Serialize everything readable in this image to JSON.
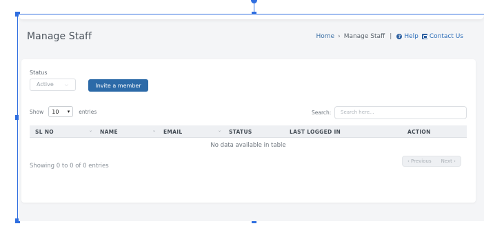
{
  "page": {
    "title": "Manage Staff"
  },
  "breadcrumb": {
    "home": "Home",
    "separator": "›",
    "current": "Manage Staff",
    "divider": "|",
    "help": "Help",
    "contact": "Contact Us"
  },
  "filters": {
    "status_label": "Status",
    "status_value": "Active",
    "invite_button": "Invite a member"
  },
  "table_controls": {
    "show_label": "Show",
    "page_length": "10",
    "entries_label": "entries",
    "search_label": "Search:",
    "search_placeholder": "Search here..."
  },
  "table": {
    "columns": [
      "SL NO",
      "NAME",
      "EMAIL",
      "STATUS",
      "LAST LOGGED IN",
      "ACTION"
    ],
    "empty_message": "No data available in table",
    "info": "Showing 0 to 0 of 0 entries"
  },
  "pagination": {
    "previous": "‹ Previous",
    "next": "Next ›"
  },
  "icons": {
    "help": "question-circle-icon",
    "contact": "phone-square-icon",
    "dropdown": "chevron-down-icon",
    "sort": "sort-icon"
  },
  "colors": {
    "accent": "#2c6aa8",
    "link": "#2c6db8",
    "background": "#f4f5f7",
    "selection": "#2f6ee0"
  }
}
